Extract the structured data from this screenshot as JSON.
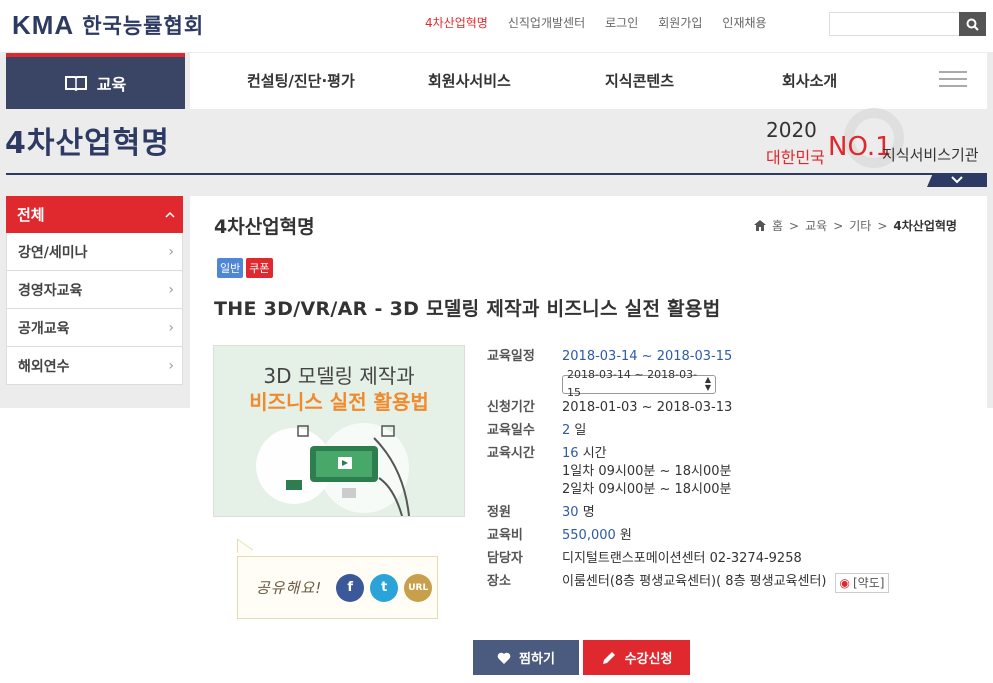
{
  "header": {
    "logo_text": "KMA",
    "logo_sub": "한국능률협회",
    "top_links": [
      "4차산업혁명",
      "신직업개발센터",
      "로그인",
      "회원가입",
      "인재채용"
    ],
    "search_placeholder": ""
  },
  "nav": {
    "edu_label": "교육",
    "items": [
      "컨설팅/진단·평가",
      "회원사서비스",
      "지식콘텐츠",
      "회사소개"
    ]
  },
  "banner": {
    "title": "4차산업혁명",
    "award_year": "2020",
    "award_l1": "대한민국",
    "award_no": "NO.1",
    "award_l2": "지식서비스기관"
  },
  "sidebar": {
    "head": "전체",
    "items": [
      {
        "label": "강연/세미나"
      },
      {
        "label": "경영자교육"
      },
      {
        "label": "공개교육"
      },
      {
        "label": "해외연수"
      }
    ]
  },
  "content": {
    "title": "4차산업혁명",
    "breadcrumb": [
      "홈",
      "교육",
      "기타",
      "4차산업혁명"
    ],
    "badges": [
      "일반",
      "쿠폰"
    ],
    "course_title": "THE 3D/VR/AR - 3D 모델링 제작과 비즈니스 실전 활용법",
    "thumb_line1": "3D 모델링 제작과",
    "thumb_line2": "비즈니스 실전 활용법",
    "share_label": "공유해요!",
    "share_url": "URL"
  },
  "details": {
    "k_date": "교육일정",
    "v_date": "2018-03-14 ~ 2018-03-15",
    "select_value": "2018-03-14 ~ 2018-03-15",
    "k_apply": "신청기간",
    "v_apply": "2018-01-03 ~ 2018-03-13",
    "k_days": "교육일수",
    "v_days_num": "2",
    "v_days_unit": "일",
    "k_hours": "교육시간",
    "v_hours_num": "16",
    "v_hours_unit": "시간",
    "v_hours_d1": "1일차 09시00분 ~ 18시00분",
    "v_hours_d2": "2일차 09시00분 ~ 18시00분",
    "k_cap": "정원",
    "v_cap_num": "30",
    "v_cap_unit": "명",
    "k_fee": "교육비",
    "v_fee_num": "550,000",
    "v_fee_unit": "원",
    "k_contact": "담당자",
    "v_contact": "디지털트랜스포메이션센터 02-3274-9258",
    "k_place": "장소",
    "v_place": "이룸센터(8층 평생교육센터)( 8층 평생교육센터)",
    "map_label": "[약도]"
  },
  "buttons": {
    "like": "찜하기",
    "apply": "수강신청"
  },
  "colors": {
    "accent": "#e0292e",
    "navy": "#2d3a63",
    "link": "#2e5aa8"
  }
}
